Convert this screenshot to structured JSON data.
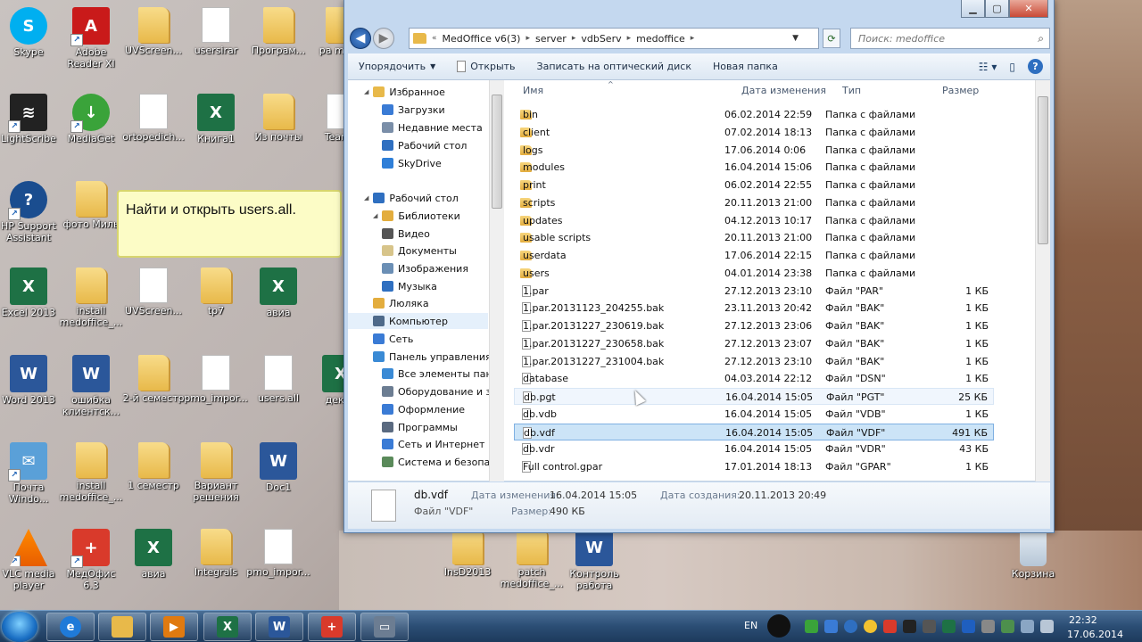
{
  "desktop": {
    "icons": [
      {
        "label": "Skype",
        "icon": "skype-icon"
      },
      {
        "label": "Adobe Reader XI",
        "icon": "adobe-reader-icon"
      },
      {
        "label": "UVScreen...",
        "icon": "folder-icon"
      },
      {
        "label": "usersirar",
        "icon": "file-icon"
      },
      {
        "label": "Програм...",
        "icon": "folder-icon"
      },
      {
        "label": "pa medo",
        "icon": "folder-icon"
      },
      {
        "label": "LightScribe",
        "icon": "lightscribe-icon"
      },
      {
        "label": "MediaGet",
        "icon": "mediaget-icon"
      },
      {
        "label": "ortopedich...",
        "icon": "archive-icon"
      },
      {
        "label": "Книга1",
        "icon": "excel-icon"
      },
      {
        "label": "Из почты",
        "icon": "folder-icon"
      },
      {
        "label": "TeamV",
        "icon": "file-icon"
      },
      {
        "label": "HP Support Assistant",
        "icon": "help-icon"
      },
      {
        "label": "фото Миль",
        "icon": "folder-icon"
      },
      {
        "label": "Excel 2013",
        "icon": "excel-icon"
      },
      {
        "label": "install medoffice_...",
        "icon": "folder-icon"
      },
      {
        "label": "UVScreen...",
        "icon": "file-icon"
      },
      {
        "label": "tp7",
        "icon": "folder-icon"
      },
      {
        "label": "авиа",
        "icon": "excel-icon"
      },
      {
        "label": "Word 2013",
        "icon": "word-icon"
      },
      {
        "label": "ошибка клиентск...",
        "icon": "word-icon"
      },
      {
        "label": "2-й семестр",
        "icon": "folder-icon"
      },
      {
        "label": "pmo_impor...",
        "icon": "file-icon"
      },
      {
        "label": "users.all",
        "icon": "file-icon"
      },
      {
        "label": "декла",
        "icon": "excel-icon"
      },
      {
        "label": "Почта Windo...",
        "icon": "mail-icon"
      },
      {
        "label": "install medoffice_...",
        "icon": "folder-icon"
      },
      {
        "label": "1 семестр",
        "icon": "folder-icon"
      },
      {
        "label": "Вариант решения",
        "icon": "folder-icon"
      },
      {
        "label": "Doc1",
        "icon": "word-icon"
      },
      {
        "label": "VLC media player",
        "icon": "vlc-icon"
      },
      {
        "label": "МедОфис 6.3",
        "icon": "medoffice-icon"
      },
      {
        "label": "авиа",
        "icon": "excel-icon"
      },
      {
        "label": "Integrals",
        "icon": "folder-icon"
      },
      {
        "label": "pmo_impor...",
        "icon": "file-icon"
      },
      {
        "label": "InsD2013",
        "icon": "folder-icon"
      },
      {
        "label": "patch medoffice_...",
        "icon": "folder-icon"
      },
      {
        "label": "Контроль работа",
        "icon": "word-icon"
      },
      {
        "label": "Корзина",
        "icon": "recycle-bin-icon"
      }
    ]
  },
  "tooltip": {
    "text": "Найти и открыть users.all."
  },
  "explorer": {
    "breadcrumb": [
      "MedOffice v6(3)",
      "server",
      "vdbServ",
      "medoffice"
    ],
    "search_placeholder": "Поиск: medoffice",
    "toolbar": {
      "organize": "Упорядочить",
      "open": "Открыть",
      "burn": "Записать на оптический диск",
      "new_folder": "Новая папка"
    },
    "nav": [
      {
        "label": "Избранное",
        "icon": "favorites-star-icon",
        "color": "#e8b94a"
      },
      {
        "label": "Загрузки",
        "icon": "downloads-icon",
        "color": "#3a7bd5"
      },
      {
        "label": "Недавние места",
        "icon": "recent-places-icon",
        "color": "#7a8ea8"
      },
      {
        "label": "Рабочий стол",
        "icon": "desktop-icon",
        "color": "#2f6fc0"
      },
      {
        "label": "SkyDrive",
        "icon": "skydrive-icon",
        "color": "#2f7fd8"
      },
      {
        "label": "Рабочий стол",
        "icon": "desktop-icon",
        "color": "#2f6fc0"
      },
      {
        "label": "Библиотеки",
        "icon": "libraries-icon",
        "color": "#e3ad3e"
      },
      {
        "label": "Видео",
        "icon": "video-icon",
        "color": "#555555"
      },
      {
        "label": "Документы",
        "icon": "documents-icon",
        "color": "#d7c48a"
      },
      {
        "label": "Изображения",
        "icon": "pictures-icon",
        "color": "#6b8fb5"
      },
      {
        "label": "Музыка",
        "icon": "music-icon",
        "color": "#2f6fc0"
      },
      {
        "label": "Люляка",
        "icon": "user-icon",
        "color": "#e3ad3e"
      },
      {
        "label": "Компьютер",
        "icon": "computer-icon",
        "color": "#4f6a8a"
      },
      {
        "label": "Сеть",
        "icon": "network-icon",
        "color": "#3a7bd5"
      },
      {
        "label": "Панель управления",
        "icon": "control-panel-icon",
        "color": "#3a8ad5"
      },
      {
        "label": "Все элементы пане",
        "icon": "control-panel-icon",
        "color": "#3a8ad5"
      },
      {
        "label": "Оборудование и зв",
        "icon": "hardware-icon",
        "color": "#6c7d92"
      },
      {
        "label": "Оформление",
        "icon": "appearance-icon",
        "color": "#3a7bd5"
      },
      {
        "label": "Программы",
        "icon": "programs-icon",
        "color": "#5a6a80"
      },
      {
        "label": "Сеть и Интернет",
        "icon": "network-internet-icon",
        "color": "#3a7bd5"
      },
      {
        "label": "Система и безопас",
        "icon": "security-icon",
        "color": "#5a8a5a"
      }
    ],
    "columns": {
      "name": "Имя",
      "date": "Дата изменения",
      "type": "Тип",
      "size": "Размер"
    },
    "files": [
      {
        "name": "bin",
        "date": "06.02.2014 22:59",
        "type": "Папка с файлами",
        "size": "",
        "kind": "dir"
      },
      {
        "name": "client",
        "date": "07.02.2014 18:13",
        "type": "Папка с файлами",
        "size": "",
        "kind": "dir"
      },
      {
        "name": "logs",
        "date": "17.06.2014 0:06",
        "type": "Папка с файлами",
        "size": "",
        "kind": "dir"
      },
      {
        "name": "modules",
        "date": "16.04.2014 15:06",
        "type": "Папка с файлами",
        "size": "",
        "kind": "dir"
      },
      {
        "name": "print",
        "date": "06.02.2014 22:55",
        "type": "Папка с файлами",
        "size": "",
        "kind": "dir"
      },
      {
        "name": "scripts",
        "date": "20.11.2013 21:00",
        "type": "Папка с файлами",
        "size": "",
        "kind": "dir"
      },
      {
        "name": "updates",
        "date": "04.12.2013 10:17",
        "type": "Папка с файлами",
        "size": "",
        "kind": "dir"
      },
      {
        "name": "usable scripts",
        "date": "20.11.2013 21:00",
        "type": "Папка с файлами",
        "size": "",
        "kind": "dir"
      },
      {
        "name": "userdata",
        "date": "17.06.2014 22:15",
        "type": "Папка с файлами",
        "size": "",
        "kind": "dir"
      },
      {
        "name": "users",
        "date": "04.01.2014 23:38",
        "type": "Папка с файлами",
        "size": "",
        "kind": "dir"
      },
      {
        "name": "1.par",
        "date": "27.12.2013 23:10",
        "type": "Файл \"PAR\"",
        "size": "1 КБ",
        "kind": "file"
      },
      {
        "name": "1.par.20131123_204255.bak",
        "date": "23.11.2013 20:42",
        "type": "Файл \"BAK\"",
        "size": "1 КБ",
        "kind": "file"
      },
      {
        "name": "1.par.20131227_230619.bak",
        "date": "27.12.2013 23:06",
        "type": "Файл \"BAK\"",
        "size": "1 КБ",
        "kind": "file"
      },
      {
        "name": "1.par.20131227_230658.bak",
        "date": "27.12.2013 23:07",
        "type": "Файл \"BAK\"",
        "size": "1 КБ",
        "kind": "file"
      },
      {
        "name": "1.par.20131227_231004.bak",
        "date": "27.12.2013 23:10",
        "type": "Файл \"BAK\"",
        "size": "1 КБ",
        "kind": "file"
      },
      {
        "name": "database",
        "date": "04.03.2014 22:12",
        "type": "Файл \"DSN\"",
        "size": "1 КБ",
        "kind": "file"
      },
      {
        "name": "db.pgt",
        "date": "16.04.2014 15:05",
        "type": "Файл \"PGT\"",
        "size": "25 КБ",
        "kind": "file",
        "state": "hover"
      },
      {
        "name": "db.vdb",
        "date": "16.04.2014 15:05",
        "type": "Файл \"VDB\"",
        "size": "1 КБ",
        "kind": "file"
      },
      {
        "name": "db.vdf",
        "date": "16.04.2014 15:05",
        "type": "Файл \"VDF\"",
        "size": "491 КБ",
        "kind": "file",
        "state": "sel"
      },
      {
        "name": "db.vdr",
        "date": "16.04.2014 15:05",
        "type": "Файл \"VDR\"",
        "size": "43 КБ",
        "kind": "file"
      },
      {
        "name": "Full control.gpar",
        "date": "17.01.2014 18:13",
        "type": "Файл \"GPAR\"",
        "size": "1 КБ",
        "kind": "file"
      }
    ],
    "details": {
      "name": "db.vdf",
      "type": "Файл \"VDF\"",
      "modified_label": "Дата изменения:",
      "modified": "16.04.2014 15:05",
      "created_label": "Дата создания:",
      "created": "20.11.2013 20:49",
      "size_label": "Размер:",
      "size": "490 КБ"
    }
  },
  "taskbar": {
    "lang": "EN",
    "time": "22:32",
    "date": "17.06.2014"
  }
}
